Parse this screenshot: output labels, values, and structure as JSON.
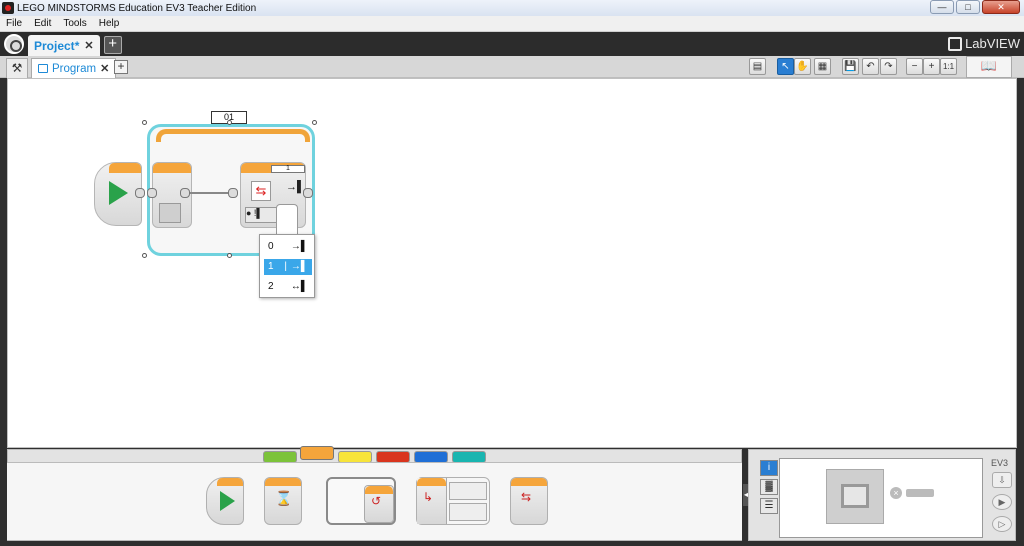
{
  "window": {
    "title": "LEGO MINDSTORMS Education EV3 Teacher Edition",
    "buttons": {
      "minimize": "—",
      "maximize": "□",
      "close": "✕"
    }
  },
  "menu": {
    "items": [
      "File",
      "Edit",
      "Tools",
      "Help"
    ]
  },
  "project_bar": {
    "tab_label": "Project",
    "modified_marker": "*",
    "close": "✕",
    "add": "+",
    "brand": "LabVIEW"
  },
  "program_bar": {
    "tab_label": "Program",
    "close": "✕",
    "add": "+",
    "wrench": "⚒",
    "help": "📖"
  },
  "toolbar": {
    "new_comment": "▤",
    "select": "↖",
    "pan": "✋",
    "comment": "▦",
    "save": "💾",
    "undo": "↶",
    "redo": "↷",
    "zoom_out": "−",
    "zoom_in": "+",
    "zoom_reset": "1:1"
  },
  "canvas": {
    "loop_name": "01",
    "switch_value": "1",
    "switch_side_icon": "→▌",
    "switch_settings_text": "● !▌"
  },
  "dropdown": {
    "options": [
      {
        "label": "0",
        "icon": "→▌"
      },
      {
        "label": "1",
        "icon": "→▌"
      },
      {
        "label": "2",
        "icon": "↔▌"
      }
    ],
    "selected_index": 1,
    "selected_marker": "|"
  },
  "palette": {
    "categories": [
      {
        "name": "action",
        "color": "#7cc33a"
      },
      {
        "name": "flow",
        "color": "#f5a53b"
      },
      {
        "name": "sensor",
        "color": "#f7e43a"
      },
      {
        "name": "data",
        "color": "#d9351e"
      },
      {
        "name": "advanced",
        "color": "#1f6fd6"
      },
      {
        "name": "myblocks",
        "color": "#19b5b0"
      }
    ],
    "selected_category": 1
  },
  "hardware": {
    "ev3_label": "EV3",
    "collapse": "◀",
    "side_buttons": [
      "i",
      "▓",
      "☰"
    ]
  }
}
